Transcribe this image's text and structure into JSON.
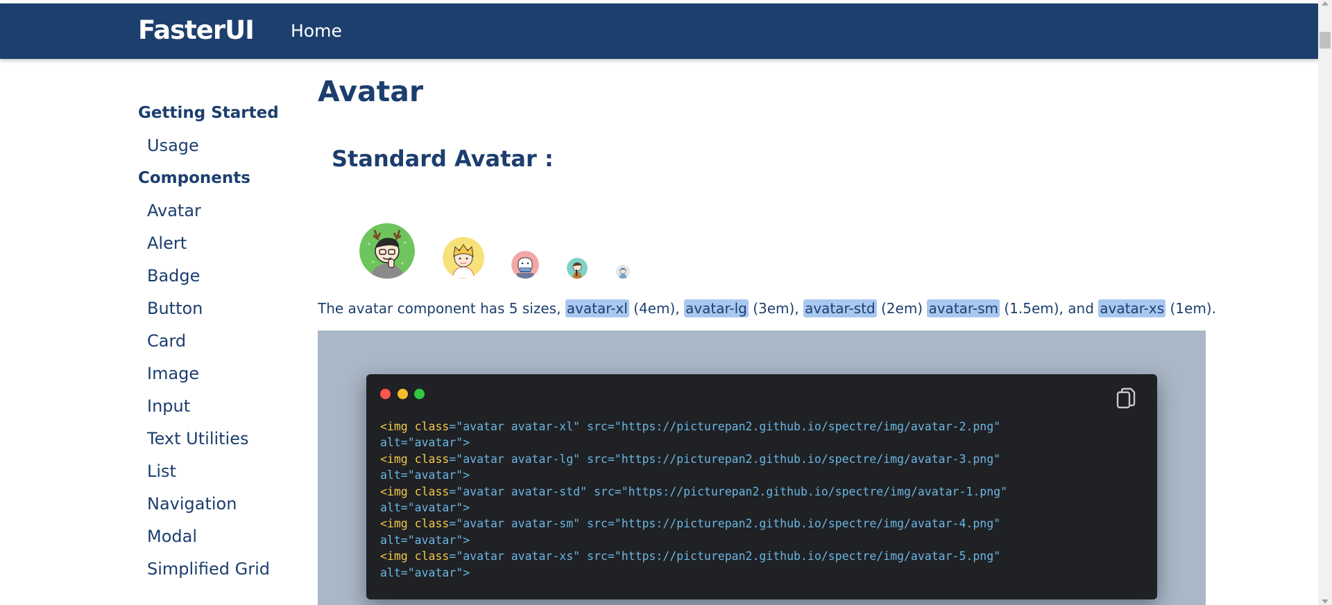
{
  "navbar": {
    "brand": "FasterUI",
    "home": "Home"
  },
  "sidebar": {
    "getting_started": "Getting Started",
    "getting_started_items": [
      "Usage"
    ],
    "components": "Components",
    "component_items": [
      "Avatar",
      "Alert",
      "Badge",
      "Button",
      "Card",
      "Image",
      "Input",
      "Text Utilities",
      "List",
      "Navigation",
      "Modal",
      "Simplified Grid"
    ]
  },
  "main": {
    "title": "Avatar",
    "section_title": "Standard Avatar :",
    "desc": {
      "prefix": "The avatar component has 5 sizes, ",
      "c1": "avatar-xl",
      "t1": " (4em), ",
      "c2": "avatar-lg",
      "t2": " (3em), ",
      "c3": "avatar-std",
      "t3": " (2em) ",
      "c4": "avatar-sm",
      "t4": " (1.5em), and ",
      "c5": "avatar-xs",
      "t5": " (1em)."
    },
    "code_lines": [
      {
        "open": "<img ",
        "attr": "class",
        "eq": "=",
        "cls": "\"avatar avatar-xl\"",
        "src": " src=\"https://picturepan2.github.io/spectre/img/avatar-2.png\"",
        "alt": "alt=\"avatar\">"
      },
      {
        "open": "<img ",
        "attr": "class",
        "eq": "=",
        "cls": "\"avatar avatar-lg\"",
        "src": " src=\"https://picturepan2.github.io/spectre/img/avatar-3.png\"",
        "alt": "alt=\"avatar\">"
      },
      {
        "open": "<img ",
        "attr": "class",
        "eq": "=",
        "cls": "\"avatar avatar-std\"",
        "src": " src=\"https://picturepan2.github.io/spectre/img/avatar-1.png\"",
        "alt": "alt=\"avatar\">"
      },
      {
        "open": "<img ",
        "attr": "class",
        "eq": "=",
        "cls": "\"avatar avatar-sm\"",
        "src": " src=\"https://picturepan2.github.io/spectre/img/avatar-4.png\"",
        "alt": "alt=\"avatar\">"
      },
      {
        "open": "<img ",
        "attr": "class",
        "eq": "=",
        "cls": "\"avatar avatar-xs\"",
        "src": " src=\"https://picturepan2.github.io/spectre/img/avatar-5.png\"",
        "alt": "alt=\"avatar\">"
      }
    ]
  },
  "colors": {
    "navbar": "#1c3f6e",
    "text": "#1c3e6e",
    "code_highlight": "#a8c8f0",
    "code_bg": "#1f2124",
    "code_area_bg": "#aab7c6"
  },
  "icons": [
    "copy-icon"
  ]
}
